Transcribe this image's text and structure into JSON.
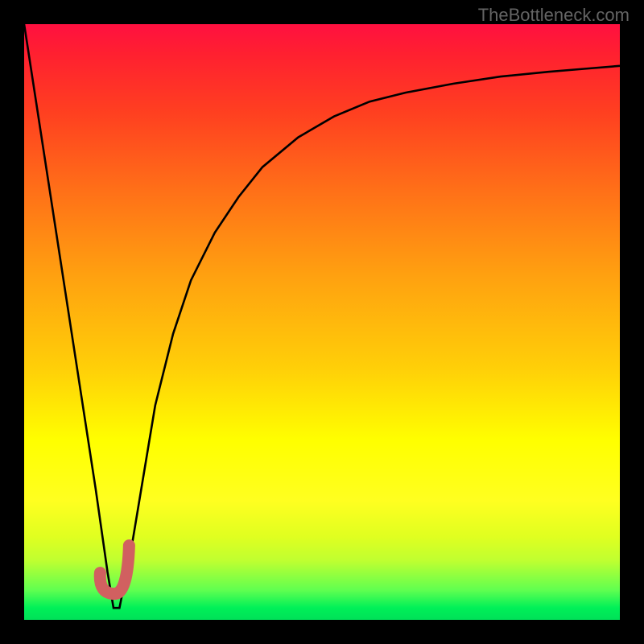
{
  "watermark": "TheBottleneck.com",
  "chart_data": {
    "type": "line",
    "title": "",
    "xlabel": "",
    "ylabel": "",
    "xlim": [
      0,
      100
    ],
    "ylim": [
      0,
      100
    ],
    "grid": false,
    "series": [
      {
        "name": "bottleneck-curve",
        "x": [
          0,
          4,
          8,
          12,
          14,
          15,
          16,
          18,
          20,
          22,
          25,
          28,
          32,
          36,
          40,
          46,
          52,
          58,
          64,
          72,
          80,
          88,
          94,
          100
        ],
        "y": [
          100,
          74,
          48,
          22,
          8,
          2,
          2,
          12,
          24,
          36,
          48,
          57,
          65,
          71,
          76,
          81,
          84.5,
          87,
          88.5,
          90,
          91.2,
          92,
          92.5,
          93
        ]
      }
    ],
    "marker": {
      "name": "J-marker",
      "color": "#d16060",
      "x": 16,
      "y": 6
    },
    "background": {
      "type": "vertical-gradient",
      "stops": [
        {
          "pos": 0.0,
          "color": "#ff1040"
        },
        {
          "pos": 0.15,
          "color": "#ff4020"
        },
        {
          "pos": 0.42,
          "color": "#ffa010"
        },
        {
          "pos": 0.7,
          "color": "#ffff00"
        },
        {
          "pos": 0.9,
          "color": "#c0ff30"
        },
        {
          "pos": 1.0,
          "color": "#00e058"
        }
      ]
    }
  }
}
